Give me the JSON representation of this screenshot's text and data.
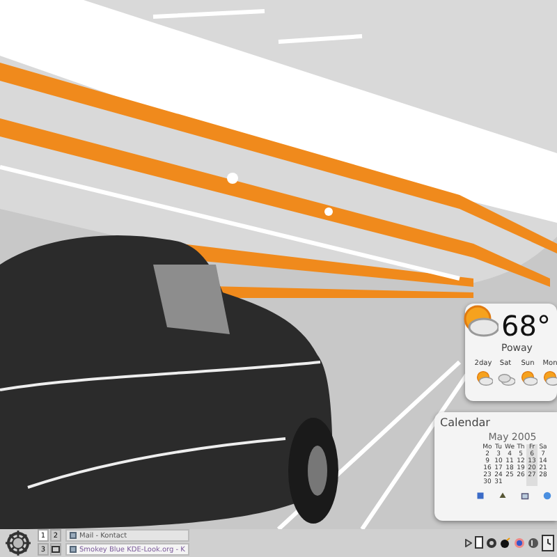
{
  "weather": {
    "temperature": "68°",
    "location": "Poway",
    "forecast": [
      {
        "day": "2day",
        "kind": "partly_cloudy"
      },
      {
        "day": "Sat",
        "kind": "cloudy"
      },
      {
        "day": "Sun",
        "kind": "partly_cloudy"
      },
      {
        "day": "Mon",
        "kind": "partly_cloudy"
      }
    ]
  },
  "calendar": {
    "title": "Calendar",
    "month": "May 2005",
    "weekdays": [
      {
        "label": "Mo",
        "selected": false
      },
      {
        "label": "Tu",
        "selected": false
      },
      {
        "label": "We",
        "selected": false
      },
      {
        "label": "Th",
        "selected": false
      },
      {
        "label": "Fr",
        "selected": true
      },
      {
        "label": "Sa",
        "selected": false
      }
    ],
    "weeks": [
      [
        "2",
        "3",
        "4",
        "5",
        "6",
        "7"
      ],
      [
        "9",
        "10",
        "11",
        "12",
        "13",
        "14"
      ],
      [
        "16",
        "17",
        "18",
        "19",
        "20",
        "21"
      ],
      [
        "23",
        "24",
        "25",
        "26",
        "27",
        "28"
      ],
      [
        "30",
        "31"
      ]
    ]
  },
  "taskbar": {
    "desktops": [
      {
        "label": "1",
        "selected": true
      },
      {
        "label": "2",
        "selected": false
      },
      {
        "label": "3",
        "selected": false
      }
    ],
    "tasks": [
      {
        "title": "Mail - Kontact",
        "selected": false
      },
      {
        "title": "Smokey Blue KDE-Look.org - K",
        "selected": true
      }
    ]
  }
}
